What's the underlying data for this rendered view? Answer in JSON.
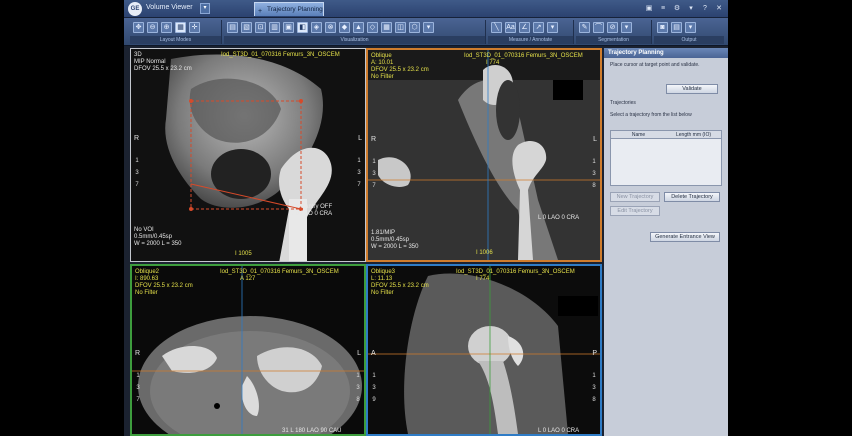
{
  "app": {
    "title": "Volume Viewer",
    "menu_label": "▾",
    "logo_text": "GE",
    "tab_label": "Trajectory Planning",
    "tab_plus": "+",
    "window_controls": [
      "▣",
      "≡",
      "⚙",
      "▾",
      "?",
      "✕"
    ]
  },
  "toolbar": {
    "groups": [
      {
        "id": "layout",
        "label": "Layout Modes",
        "icons": [
          "✥",
          "⊖",
          "⊕",
          "▦",
          "✛"
        ]
      },
      {
        "id": "visualization",
        "label": "Visualization",
        "icons": [
          "▤",
          "▧",
          "⊡",
          "▥",
          "▣",
          "◧",
          "◈",
          "⊗",
          "◆",
          "▲",
          "◇",
          "▦",
          "◫",
          "⬡",
          "▾"
        ]
      },
      {
        "id": "measure",
        "label": "Measure / Annotate",
        "icons": [
          "╲",
          "Aa",
          "∠",
          "↗",
          "▾"
        ]
      },
      {
        "id": "segmentation",
        "label": "Segmentation",
        "icons": [
          "✎",
          "⌒",
          "⊘",
          "▾"
        ]
      },
      {
        "id": "output",
        "label": "Output",
        "icons": [
          "◙",
          "▤",
          "▾"
        ]
      }
    ]
  },
  "viewports": [
    {
      "id": "3d",
      "tl": [
        "3D",
        "MIP Normal",
        "DFOV 25.5 x 23.2 cm"
      ],
      "tc": "Iod_ST3D_01_070316 Femurs_3N_OSCEM",
      "bl": [
        "No VOI",
        "0.5mm/0.45sp",
        "W = 2000 L = 350"
      ],
      "bc": "I 1005",
      "br": [
        "Gantry OFF",
        "L 0 LAO 0 CRA"
      ],
      "left": "R",
      "right": "L",
      "ruler_left": [
        "1",
        "3",
        "7"
      ],
      "ruler_right": [
        "1",
        "3",
        "7"
      ]
    },
    {
      "id": "oblique",
      "tl": [
        "Oblique",
        "A: 10.01",
        "DFOV 25.5 x 23.2 cm",
        "No Filter"
      ],
      "tc": "Iod_ST3D_01_070316 Femurs_3N_OSCEM",
      "tc2": "I 774",
      "bl": [
        "1.81/MIP",
        "0.5mm/0.45sp",
        "W = 2000 L = 350"
      ],
      "bc": "I 1006",
      "br": [
        "L 0 LAO 0 CRA"
      ],
      "left": "R",
      "right": "L",
      "ruler_left": [
        "1",
        "3",
        "7"
      ],
      "ruler_right": [
        "1",
        "3",
        "8"
      ]
    },
    {
      "id": "oblique2",
      "tl": [
        "Oblique2",
        "I: 890.63",
        "DFOV 25.5 x 23.2 cm",
        "No Filter"
      ],
      "tc": "Iod_ST3D_01_070316 Femurs_3N_OSCEM",
      "tc2": "A 127",
      "bl": [],
      "bc": "",
      "br": [
        "31 L 180 LAO 90 CAU"
      ],
      "left": "R",
      "right": "L",
      "ruler_left": [
        "1",
        "3",
        "7"
      ],
      "ruler_right": [
        "1",
        "3",
        "8"
      ]
    },
    {
      "id": "oblique3",
      "tl": [
        "Oblique3",
        "L: 11.13",
        "DFOV 25.5 x 23.2 cm",
        "No Filter"
      ],
      "tc": "Iod_ST3D_01_070316 Femurs_3N_OSCEM",
      "tc2": "I 774",
      "bl": [],
      "bc": "",
      "br": [
        "L 0 LAO 0 CRA"
      ],
      "left": "A",
      "right": "P",
      "ruler_left": [
        "1",
        "3",
        "9"
      ],
      "ruler_right": [
        "1",
        "3",
        "8"
      ]
    }
  ],
  "panel": {
    "title": "Trajectory Planning",
    "instructions": "Place cursor at target point and validate.",
    "validate_button": "Validate",
    "section_title": "Trajectories",
    "select_text": "Select a trajectory from the list below",
    "table_headers": [
      "Name",
      "Length mm (IO)"
    ],
    "buttons": [
      "New Trajectory",
      "Delete Trajectory",
      "Edit Trajectory"
    ],
    "entry_button": "Generate Entrance View"
  }
}
